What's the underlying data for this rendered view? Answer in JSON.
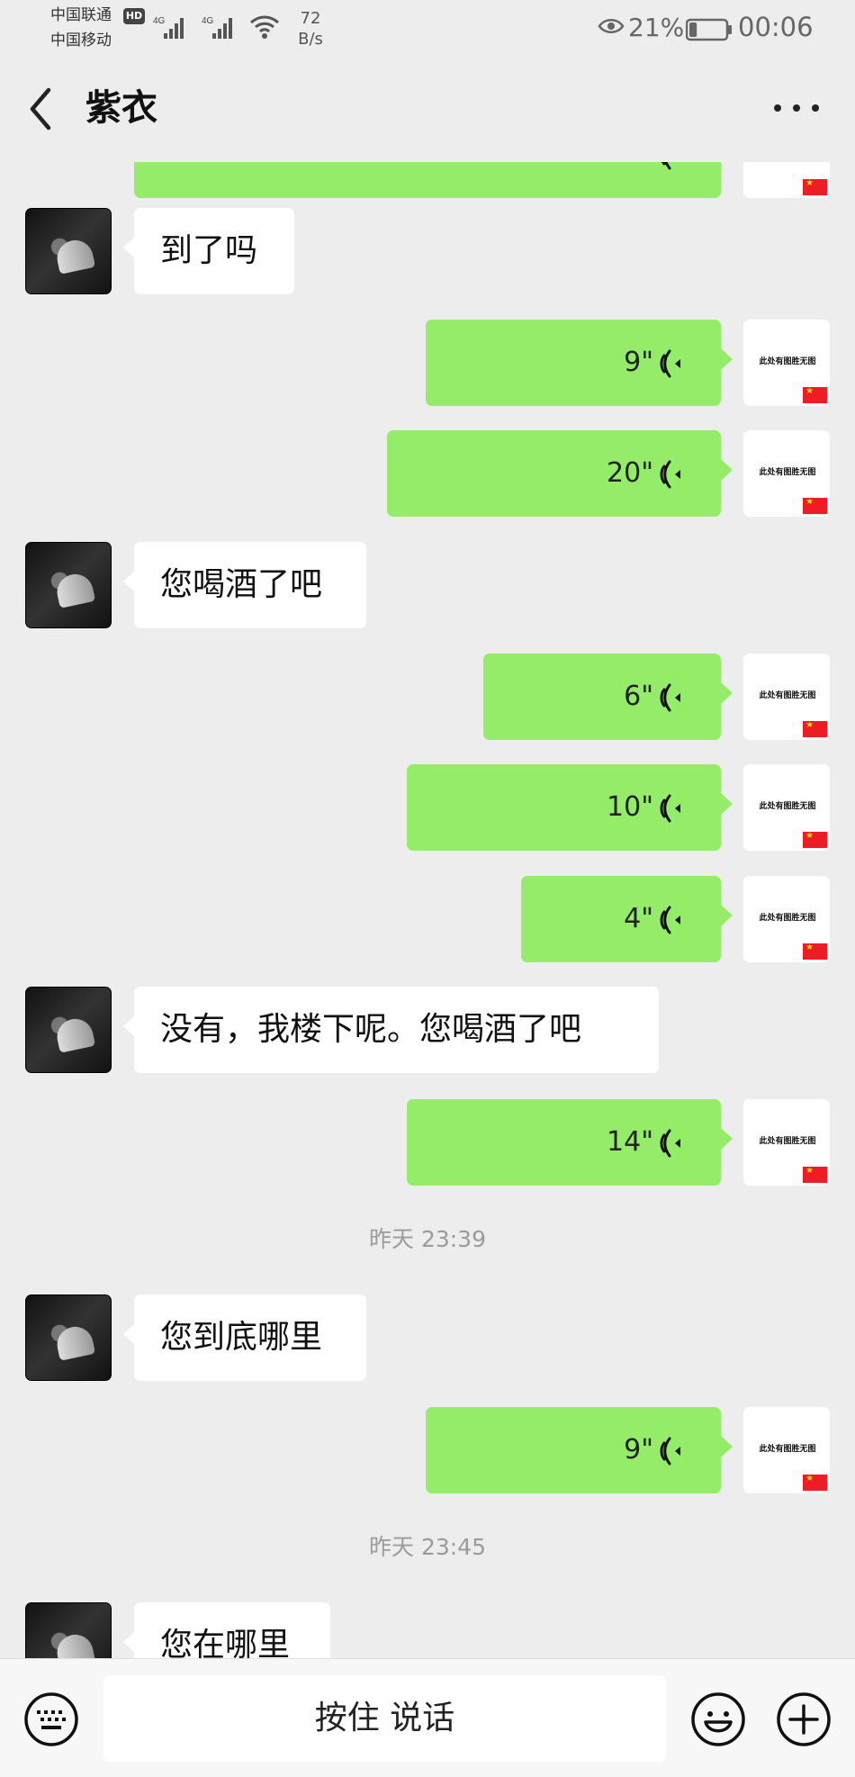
{
  "status_bar": {
    "carrier_1": "中国联通",
    "carrier_2": "中国移动",
    "hd_badge": "HD",
    "network_1": "4G",
    "network_2": "4G",
    "speed_value": "72",
    "speed_unit": "B/s",
    "battery_percent": "21%",
    "battery_level": 0.21,
    "time": "00:06",
    "icons": [
      "signal-icon",
      "wifi-icon",
      "eye-icon",
      "battery-icon"
    ]
  },
  "header": {
    "back_icon": "back-chevron-icon",
    "contact_name": "紫衣",
    "more_icon": "more-dots-icon"
  },
  "messages": [
    {
      "sender": "self",
      "type": "voice",
      "duration": "",
      "partial": true
    },
    {
      "sender": "peer",
      "type": "text",
      "text": "到了吗"
    },
    {
      "sender": "self",
      "type": "voice",
      "duration": "9\""
    },
    {
      "sender": "self",
      "type": "voice",
      "duration": "20\""
    },
    {
      "sender": "peer",
      "type": "text",
      "text": "您喝酒了吧"
    },
    {
      "sender": "self",
      "type": "voice",
      "duration": "6\""
    },
    {
      "sender": "self",
      "type": "voice",
      "duration": "10\""
    },
    {
      "sender": "self",
      "type": "voice",
      "duration": "4\""
    },
    {
      "sender": "peer",
      "type": "text",
      "text": "没有，我楼下呢。您喝酒了吧"
    },
    {
      "sender": "self",
      "type": "voice",
      "duration": "14\""
    },
    {
      "type": "timestamp",
      "text": "昨天 23:39"
    },
    {
      "sender": "peer",
      "type": "text",
      "text": "您到底哪里"
    },
    {
      "sender": "self",
      "type": "voice",
      "duration": "9\""
    },
    {
      "type": "timestamp",
      "text": "昨天 23:45"
    },
    {
      "sender": "peer",
      "type": "text",
      "text": "您在哪里",
      "partial": true
    }
  ],
  "self_avatar": {
    "text": "此处有图胜无图",
    "flag": "china-flag-icon"
  },
  "input_bar": {
    "hold_to_talk": "按住 说话",
    "icons": [
      "keyboard-icon",
      "emoji-icon",
      "plus-icon"
    ]
  },
  "colors": {
    "background": "#ededed",
    "self_bubble": "#95ec69",
    "peer_bubble": "#ffffff",
    "timestamp": "#9b9b9b"
  }
}
